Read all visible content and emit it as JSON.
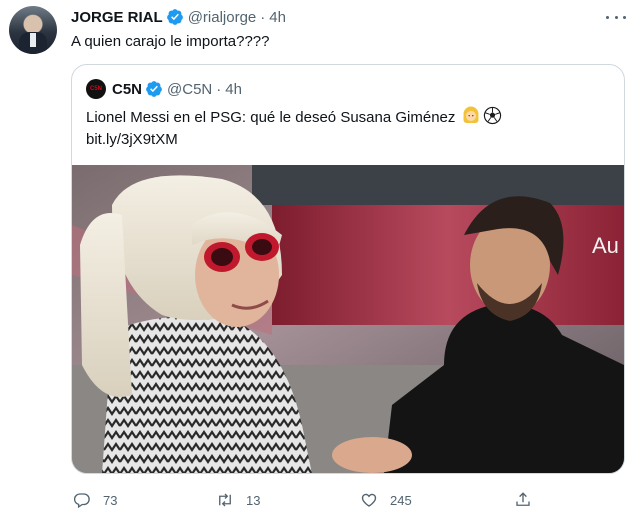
{
  "tweet": {
    "author_name": "JORGE RIAL",
    "handle": "@rialjorge",
    "separator": "·",
    "time": "4h",
    "text": "A quien carajo le importa????"
  },
  "quoted": {
    "avatar_label": "C5N",
    "author_name": "C5N",
    "handle": "@C5N",
    "separator": "·",
    "time": "4h",
    "text": "Lionel Messi en el PSG: qué le deseó Susana Giménez",
    "link": "bit.ly/3jX9tXM",
    "media_banner_text": "Au"
  },
  "actions": {
    "replies": "73",
    "retweets": "13",
    "likes": "245"
  },
  "colors": {
    "primary_text": "#0f1419",
    "secondary_text": "#536471",
    "verified_blue": "#1d9bf0",
    "border": "#cfd9de"
  },
  "icons": [
    "verified-badge-icon",
    "more-icon",
    "reply-icon",
    "retweet-icon",
    "like-icon",
    "share-icon",
    "blonde-woman-emoji-icon",
    "soccer-ball-emoji-icon"
  ]
}
